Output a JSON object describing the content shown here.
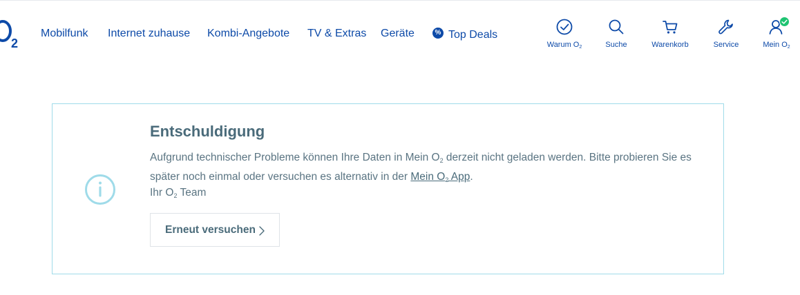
{
  "logo": {
    "text": "O",
    "sub": "2"
  },
  "nav": {
    "items": [
      {
        "label": "Mobilfunk"
      },
      {
        "label": "Internet zuhause"
      },
      {
        "label": "Kombi-Angebote"
      },
      {
        "label": "TV & Extras"
      },
      {
        "label": "Geräte"
      },
      {
        "label": "Top Deals",
        "badge": "%"
      }
    ]
  },
  "utility": {
    "warum": {
      "label": "Warum O",
      "sub": "2",
      "icon": "check-circle-icon"
    },
    "suche": {
      "label": "Suche",
      "icon": "search-icon"
    },
    "warenkorb": {
      "label": "Warenkorb",
      "icon": "cart-icon"
    },
    "service": {
      "label": "Service",
      "icon": "wrench-icon"
    },
    "mein": {
      "label": "Mein O",
      "sub": "2",
      "icon": "user-icon"
    }
  },
  "error": {
    "title": "Entschuldigung",
    "message_part1": "Aufgrund technischer Probleme können Ihre Daten in Mein O",
    "message_sub1": "2",
    "message_part2": " derzeit nicht geladen werden. Bitte probieren Sie es später noch einmal oder versuchen es alternativ in der ",
    "link_part1": "Mein O",
    "link_sub": "2",
    "link_part2": " App",
    "message_end": ".",
    "signature_part1": "Ihr O",
    "signature_sub": "2",
    "signature_part2": " Team",
    "retry_label": "Erneut versuchen"
  },
  "colors": {
    "brand_blue": "#0d4aa8",
    "card_border": "#9fdbe9",
    "text_muted": "#5a7482",
    "success_green": "#1ec472"
  }
}
